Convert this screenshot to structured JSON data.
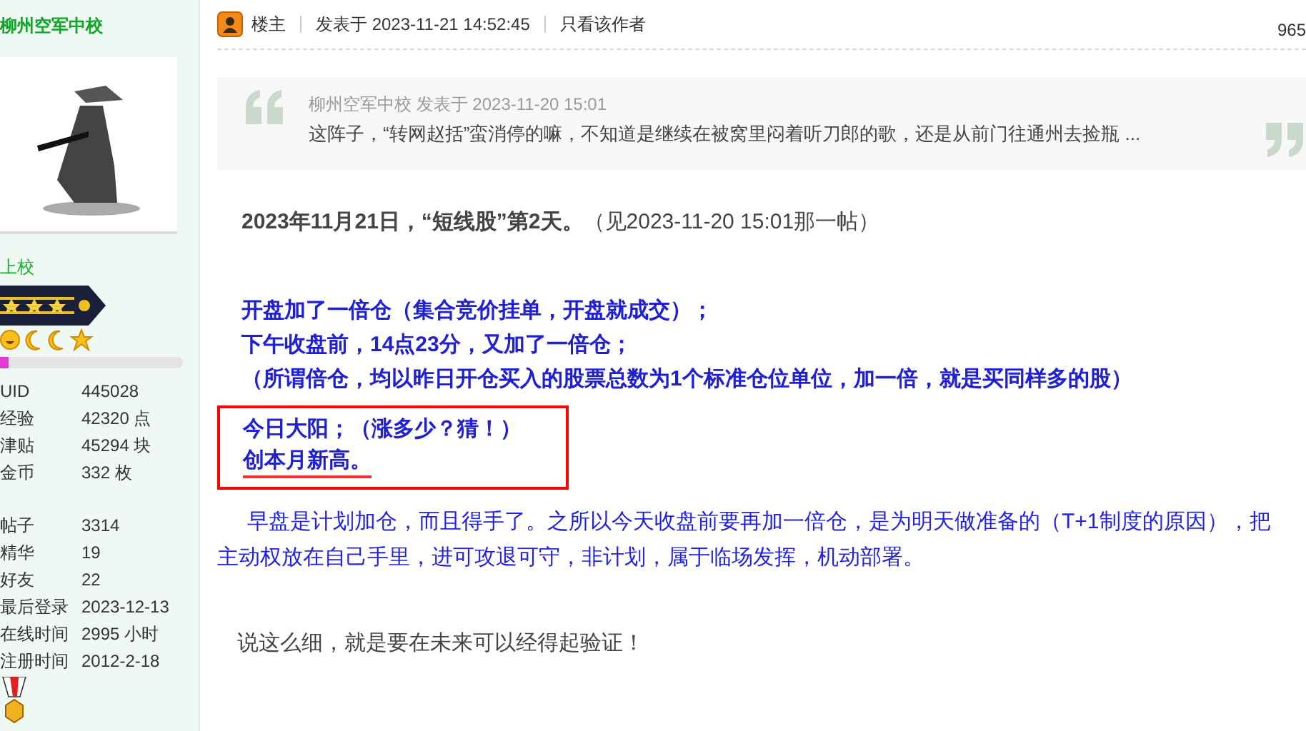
{
  "sidebar": {
    "username": "柳州空军中校",
    "rank": "上校",
    "level": 0.05,
    "stats": [
      {
        "label": "UID",
        "value": "445028"
      },
      {
        "label": "经验",
        "value": "42320 点"
      },
      {
        "label": "津贴",
        "value": "45294 块"
      },
      {
        "label": "金币",
        "value": "332 枚"
      }
    ],
    "activity": [
      {
        "label": "帖子",
        "value": "3314"
      },
      {
        "label": "精华",
        "value": "19"
      },
      {
        "label": "好友",
        "value": "22"
      },
      {
        "label": "最后登录",
        "value": "2023-12-13"
      },
      {
        "label": "在线时间",
        "value": "2995 小时"
      },
      {
        "label": "注册时间",
        "value": "2012-2-18"
      }
    ]
  },
  "post": {
    "role": "楼主",
    "posted": "发表于 2023-11-21 14:52:45",
    "author_only": "只看该作者",
    "floor": "965",
    "quote": {
      "author": "柳州空军中校 发表于 2023-11-20 15:01",
      "text": "这阵子，“转网赵括”蛮消停的嘛，不知道是继续在被窝里闷着听刀郎的歌，还是从前门往通州去捡瓶 ..."
    },
    "body": [
      {
        "kind": "title",
        "text": "**2023年11月21日，“短线股”第2天。**（见2023-11-20 15:01那一帖）"
      },
      {
        "kind": "emphasis",
        "lines": [
          {
            "text": "开盘加了一倍仓（集合竞价挂单，开盘就成交）；",
            "underlined": false
          },
          {
            "text": "下午收盘前，14点23分，又加了一倍仓；",
            "underlined": false
          },
          {
            "text": "（所谓倍仓，均以昨日开仓买入的股票总数为1个标准仓位单位，加一倍，就是买同样多的股）",
            "underlined": false
          }
        ]
      },
      {
        "kind": "boxed",
        "lines": [
          {
            "text": "今日大阳；（涨多少？猜！）",
            "underlined": false
          },
          {
            "text": "创本月新高。",
            "underlined": true
          }
        ]
      },
      {
        "kind": "paragraph",
        "text": "早盘是计划加仓，而且得手了。之所以今天收盘前要再加一倍仓，是为明天做准备的（T+1制度的原因），把主动权放在自己手里，进可攻退可守，非计划，属于临场发挥，机动部署。"
      },
      {
        "kind": "plain",
        "text": "说这么细，就是要在未来可以经得起验证！"
      }
    ]
  }
}
